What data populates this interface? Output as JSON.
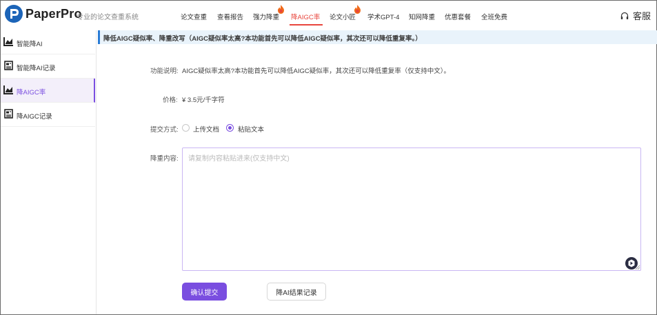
{
  "header": {
    "brand": "PaperPro",
    "tagline": "专业的论文查重系统",
    "nav": [
      {
        "label": "论文查重",
        "hot": false,
        "active": false
      },
      {
        "label": "查看报告",
        "hot": false,
        "active": false
      },
      {
        "label": "强力降重",
        "hot": true,
        "active": false
      },
      {
        "label": "降AIGC率",
        "hot": false,
        "active": true
      },
      {
        "label": "论文小匠",
        "hot": true,
        "active": false
      },
      {
        "label": "学术GPT-4",
        "hot": false,
        "active": false
      },
      {
        "label": "知网降重",
        "hot": false,
        "active": false
      },
      {
        "label": "优惠套餐",
        "hot": false,
        "active": false
      },
      {
        "label": "全班免费",
        "hot": false,
        "active": false
      }
    ],
    "service_label": "客服"
  },
  "sidebar": {
    "items": [
      {
        "label": "智能降AI",
        "icon": "chart-icon",
        "active": false
      },
      {
        "label": "智能降AI记录",
        "icon": "document-icon",
        "active": false
      },
      {
        "label": "降AIGC率",
        "icon": "chart-icon",
        "active": true
      },
      {
        "label": "降AIGC记录",
        "icon": "document-icon",
        "active": false
      }
    ]
  },
  "notice": "降低AIGC疑似率、降重改写（AIGC疑似率太高?本功能首先可以降低AIGC疑似率，其次还可以降低重复率。）",
  "form": {
    "desc_label": "功能说明:",
    "desc_text": "AIGC疑似率太高?本功能首先可以降低AIGC疑似率，其次还可以降低重复率（仅支持中文）。",
    "price_label": "价格:",
    "price_text": "¥ 3.5元/千字符",
    "submit_mode_label": "提交方式:",
    "submit_modes": [
      {
        "label": "上传文档",
        "selected": false
      },
      {
        "label": "粘贴文本",
        "selected": true
      }
    ],
    "content_label": "降重内容:",
    "content_placeholder": "请复制内容粘贴进来(仅支持中文)",
    "content_value": "",
    "submit_button": "确认提交",
    "records_button": "降AI结果记录"
  },
  "colors": {
    "accent": "#7a4ee0",
    "nav_active": "#e8453c",
    "brand_blue": "#1c64b8",
    "notice_bg": "#e9f3fb"
  }
}
